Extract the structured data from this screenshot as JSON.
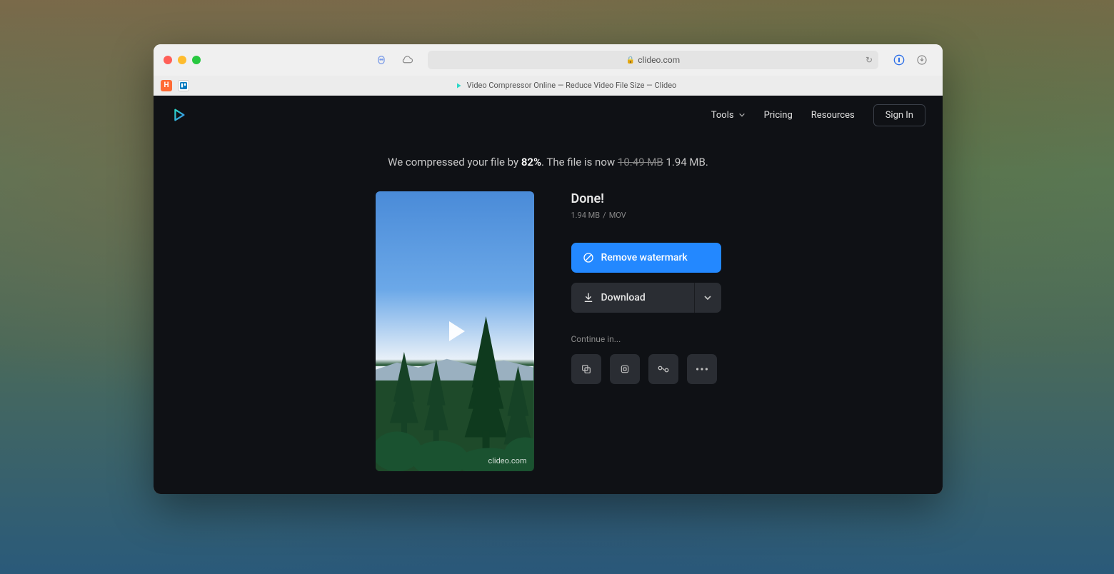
{
  "browser": {
    "address": "clideo.com",
    "tab_title": "Video Compressor Online — Reduce Video File Size — Clideo"
  },
  "nav": {
    "tools": "Tools",
    "pricing": "Pricing",
    "resources": "Resources",
    "sign_in": "Sign In"
  },
  "banner": {
    "prefix": "We compressed your file by ",
    "percent": "82%",
    "mid": ". The file is now ",
    "old_size": "10.49 MB",
    "new_size": "1.94 MB",
    "suffix": "."
  },
  "result": {
    "done": "Done!",
    "size": "1.94 MB",
    "format": "MOV",
    "watermark_domain": "clideo.com",
    "remove_watermark": "Remove watermark",
    "download": "Download",
    "continue_label": "Continue in..."
  }
}
